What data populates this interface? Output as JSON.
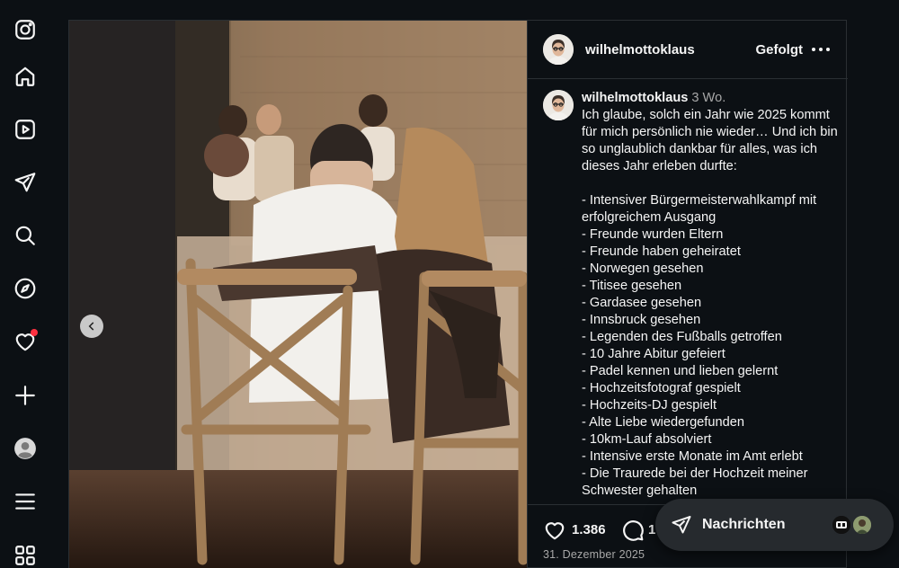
{
  "nav": {
    "items": [
      {
        "icon": "instagram-logo-icon"
      },
      {
        "icon": "home-icon"
      },
      {
        "icon": "reels-icon"
      },
      {
        "icon": "send-icon"
      },
      {
        "icon": "search-icon"
      },
      {
        "icon": "explore-compass-icon"
      },
      {
        "icon": "heart-notifications-icon",
        "badge_color": "#ff3040"
      },
      {
        "icon": "plus-create-icon"
      },
      {
        "icon": "profile-avatar-icon"
      },
      {
        "icon": "menu-icon"
      },
      {
        "icon": "more-apps-icon"
      }
    ]
  },
  "post": {
    "username": "wilhelmottoklaus",
    "follow_state": "Gefolgt",
    "caption": {
      "author": "wilhelmottoklaus",
      "age": "3 Wo.",
      "text": "Ich glaube, solch ein Jahr wie 2025 kommt für mich persönlich nie wieder… Und ich bin so unglaublich dankbar für alles, was ich dieses Jahr erleben durfte:\n\n- Intensiver Bürgermeisterwahlkampf mit erfolgreichem Ausgang\n- Freunde wurden Eltern\n- Freunde haben geheiratet\n- Norwegen gesehen\n- Titisee gesehen\n- Gardasee gesehen\n- Innsbruck gesehen\n- Legenden des Fußballs getroffen\n- 10 Jahre Abitur gefeiert\n- Padel kennen und lieben gelernt\n- Hochzeitsfotograf gespielt\n- Hochzeits-DJ gespielt\n- Alte Liebe wiedergefunden\n- 10km-Lauf absolviert\n- Intensive erste Monate im Amt erlebt\n- Die Traurede bei der Hochzeit meiner Schwester gehalten"
    },
    "likes": "1.386",
    "comments": "1",
    "date": "31. Dezember 2025"
  },
  "messages": {
    "label": "Nachrichten"
  },
  "colors": {
    "background": "#0c1014",
    "text": "#f5f5f5",
    "muted": "#a8a8a8",
    "border": "#2a2f33",
    "notification": "#ff3040"
  }
}
